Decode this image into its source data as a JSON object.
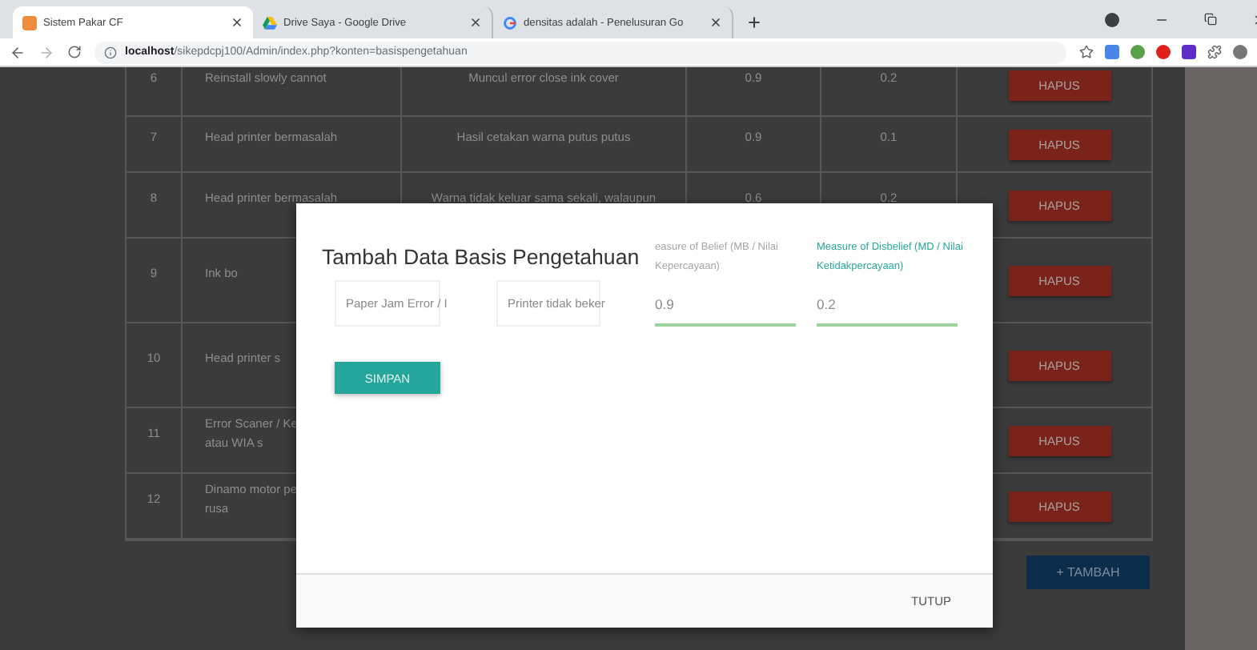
{
  "browser": {
    "tabs": [
      {
        "title": "Sistem Pakar CF",
        "selected": true
      },
      {
        "title": "Drive Saya - Google Drive",
        "selected": false
      },
      {
        "title": "densitas adalah - Penelusuran Go",
        "selected": false
      }
    ],
    "url": "**localhost**/sikepdcpj100/Admin/index.php?konten=basispengetahuan"
  },
  "table": {
    "rows": [
      {
        "no": "6",
        "name": [
          "Reinstall slowly cannot"
        ],
        "symptom": "Muncul error close ink cover",
        "mb": "0.9",
        "md": "0.2",
        "action": "HAPUS"
      },
      {
        "no": "7",
        "name": [
          "Head printer bermasalah"
        ],
        "symptom": "Hasil cetakan warna putus putus",
        "mb": "0.9",
        "md": "0.1",
        "action": "HAPUS"
      },
      {
        "no": "8",
        "name": [
          "Head printer bermasalah"
        ],
        "symptom": "Warna tidak keluar sama sekali, walaupun",
        "mb": "0.6",
        "md": "0.2",
        "action": "HAPUS"
      },
      {
        "no": "9",
        "name": [
          "Ink bo"
        ],
        "action": "HAPUS"
      },
      {
        "no": "10",
        "name": [
          "Head printer s"
        ],
        "action": "HAPUS"
      },
      {
        "no": "11",
        "name": [
          "Error Scaner / Ke",
          "atau WIA s"
        ],
        "action": "HAPUS"
      },
      {
        "no": "12",
        "name": [
          "Dinamo motor pe",
          "rusa"
        ],
        "action": "HAPUS"
      }
    ]
  },
  "add_button": "+ TAMBAH",
  "modal": {
    "title": "Tambah Data Basis Pengetahuan",
    "selects": [
      {
        "value": "Paper Jam Error / I"
      },
      {
        "value": "Printer tidak beker"
      }
    ],
    "fields": [
      {
        "label": "easure of Belief (MB / Nilai Kepercayaan)",
        "value": "0.9",
        "active": false,
        "valid": true
      },
      {
        "label": "Measure of Disbelief (MD / Nilai Ketidakpercayaan)",
        "value": "0.2",
        "active": true,
        "valid": true
      }
    ],
    "save_button": "SIMPAN",
    "close_button": "TUTUP"
  }
}
